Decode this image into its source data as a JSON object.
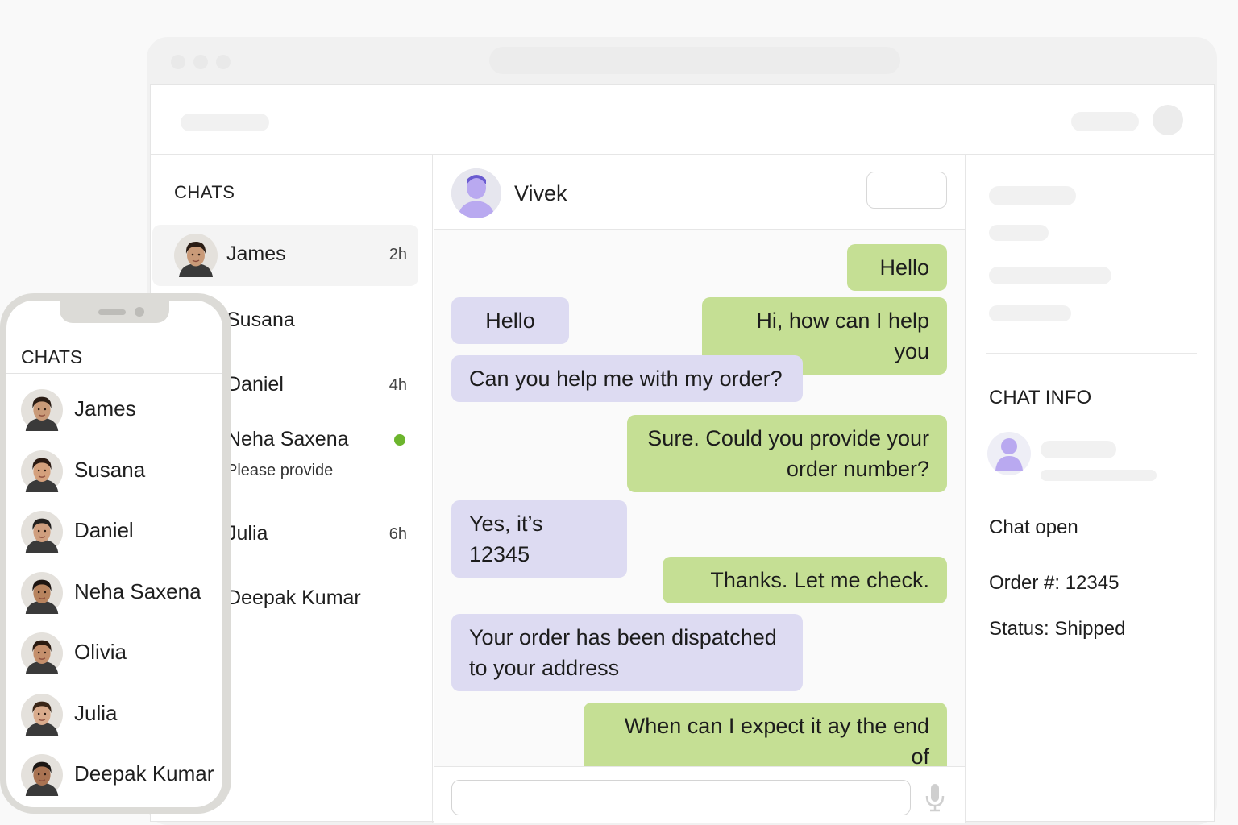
{
  "desktop": {
    "chat_list": {
      "title": "CHATS",
      "items": [
        {
          "name": "James",
          "time": "2h",
          "preview": "",
          "online": false,
          "active": true,
          "skin": "#c99a78",
          "hair": "#2a1c14"
        },
        {
          "name": "Susana",
          "time": "",
          "preview": "",
          "online": false,
          "active": false,
          "skin": "#d4a07c",
          "hair": "#2b1a12"
        },
        {
          "name": "Daniel",
          "time": "4h",
          "preview": "",
          "online": false,
          "active": false,
          "skin": "#cf9e7e",
          "hair": "#23201e"
        },
        {
          "name": "Neha Saxena",
          "time": "",
          "preview": "Please provide",
          "online": true,
          "active": false,
          "skin": "#b7835e",
          "hair": "#1d1410"
        },
        {
          "name": "Julia",
          "time": "6h",
          "preview": "",
          "online": false,
          "active": false,
          "skin": "#d9ab8c",
          "hair": "#3a2618"
        },
        {
          "name": "Deepak Kumar",
          "time": "",
          "preview": "",
          "online": false,
          "active": false,
          "skin": "#a97352",
          "hair": "#1b1613"
        }
      ]
    },
    "conversation": {
      "contact_name": "Vivek",
      "messages": [
        {
          "dir": "out",
          "text": "Hello"
        },
        {
          "dir": "in",
          "text": "Hello"
        },
        {
          "dir": "out",
          "text": "Hi, how can I help you"
        },
        {
          "dir": "in",
          "text": "Can you help me with my order?"
        },
        {
          "dir": "out",
          "text": "Sure. Could you provide your order number?"
        },
        {
          "dir": "in",
          "text": "Yes, it’s 12345"
        },
        {
          "dir": "out",
          "text": "Thanks. Let me check."
        },
        {
          "dir": "in",
          "text": "Your order has been dispatched to your address"
        },
        {
          "dir": "out",
          "text": "When can I expect it  ay the end of"
        }
      ]
    },
    "info_panel": {
      "title": "CHAT INFO",
      "chat_status": "Chat open",
      "order": "Order #: 12345",
      "status": "Status: Shipped"
    }
  },
  "mobile": {
    "title": "CHATS",
    "items": [
      {
        "name": "James",
        "skin": "#c99a78",
        "hair": "#2a1c14"
      },
      {
        "name": "Susana",
        "skin": "#d4a07c",
        "hair": "#2b1a12"
      },
      {
        "name": "Daniel",
        "skin": "#cf9e7e",
        "hair": "#23201e"
      },
      {
        "name": "Neha Saxena",
        "skin": "#b7835e",
        "hair": "#1d1410"
      },
      {
        "name": "Olivia",
        "skin": "#c48f6c",
        "hair": "#2a1a10"
      },
      {
        "name": "Julia",
        "skin": "#d9ab8c",
        "hair": "#3a2618"
      },
      {
        "name": "Deepak Kumar",
        "skin": "#a97352",
        "hair": "#1b1613"
      }
    ]
  },
  "colors": {
    "incoming_bubble": "#dddbf2",
    "outgoing_bubble": "#c5df94",
    "online_dot": "#6cb52d",
    "placeholder_avatar": "#b9a9f0"
  }
}
